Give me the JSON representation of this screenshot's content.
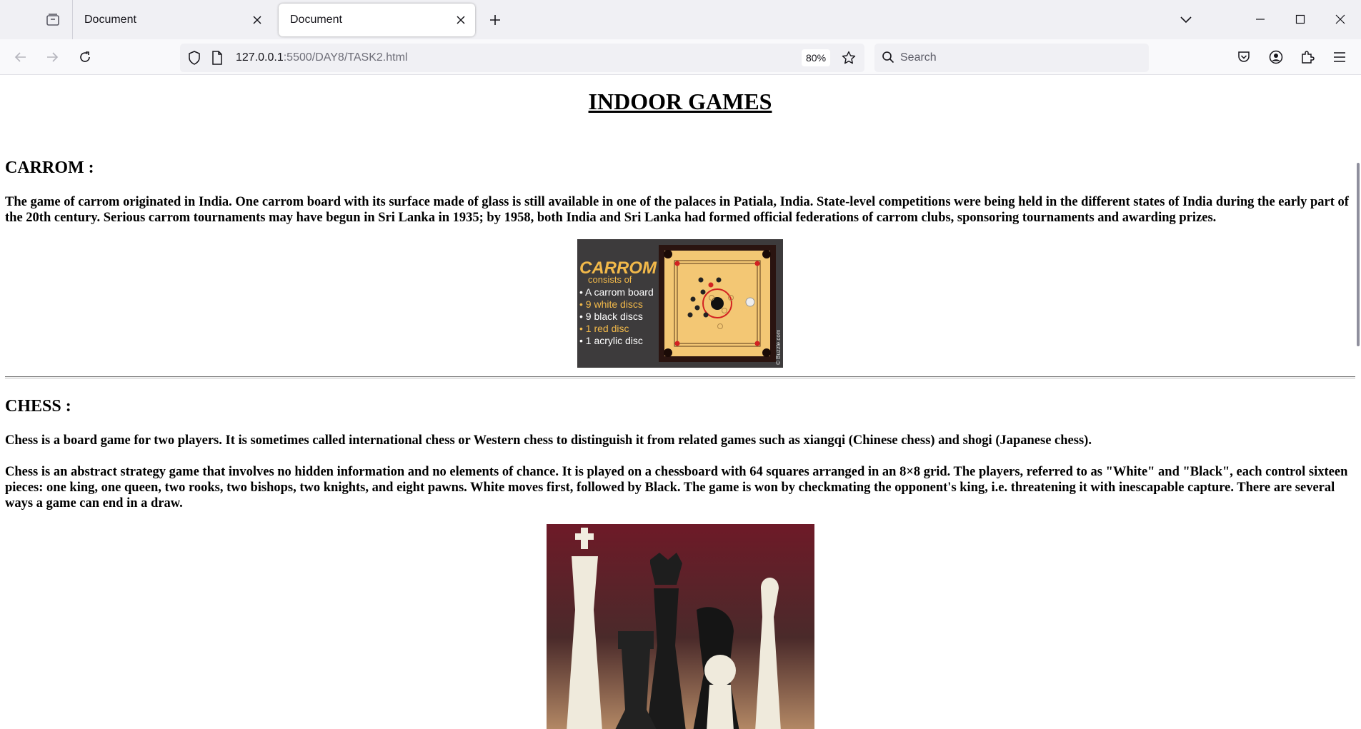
{
  "browser": {
    "tabs": [
      {
        "title": "Document",
        "active": false
      },
      {
        "title": "Document",
        "active": true
      }
    ],
    "url_host": "127.0.0.1",
    "url_path": ":5500/DAY8/TASK2.html",
    "zoom": "80%",
    "search_placeholder": "Search"
  },
  "page": {
    "title": "INDOOR GAMES",
    "carrom": {
      "heading": "CARROM :",
      "paragraph": "The game of carrom originated in India. One carrom board with its surface made of glass is still available in one of the palaces in Patiala, India. State-level competitions were being held in the different states of India during the early part of the 20th century. Serious carrom tournaments may have begun in Sri Lanka in 1935; by 1958, both India and Sri Lanka had formed official federations of carrom clubs, sponsoring tournaments and awarding prizes.",
      "image": {
        "logo": "CARROM",
        "consists_of": "consists of",
        "items": [
          "• A carrom board",
          "• 9 white discs",
          "• 9 black discs",
          "• 1 red disc",
          "• 1 acrylic disc"
        ],
        "credit": "© Buzzle.com"
      }
    },
    "chess": {
      "heading": "CHESS :",
      "paragraph1": "Chess is a board game for two players. It is sometimes called international chess or Western chess to distinguish it from related games such as xiangqi (Chinese chess) and shogi (Japanese chess).",
      "paragraph2": "Chess is an abstract strategy game that involves no hidden information and no elements of chance. It is played on a chessboard with 64 squares arranged in an 8×8 grid. The players, referred to as \"White\" and \"Black\", each control sixteen pieces: one king, one queen, two rooks, two bishops, two knights, and eight pawns. White moves first, followed by Black. The game is won by checkmating the opponent's king, i.e. threatening it with inescapable capture. There are several ways a game can end in a draw."
    }
  },
  "colors": {
    "tabbar_bg": "#f0f0f4",
    "navbar_bg": "#f9f9fb",
    "icon": "#5b5b66",
    "carrom_panel": "#3d3b3c",
    "carrom_board": "#f3c774",
    "carrom_logo": "#f2b94a",
    "chess_bg": "#6e1a28"
  }
}
